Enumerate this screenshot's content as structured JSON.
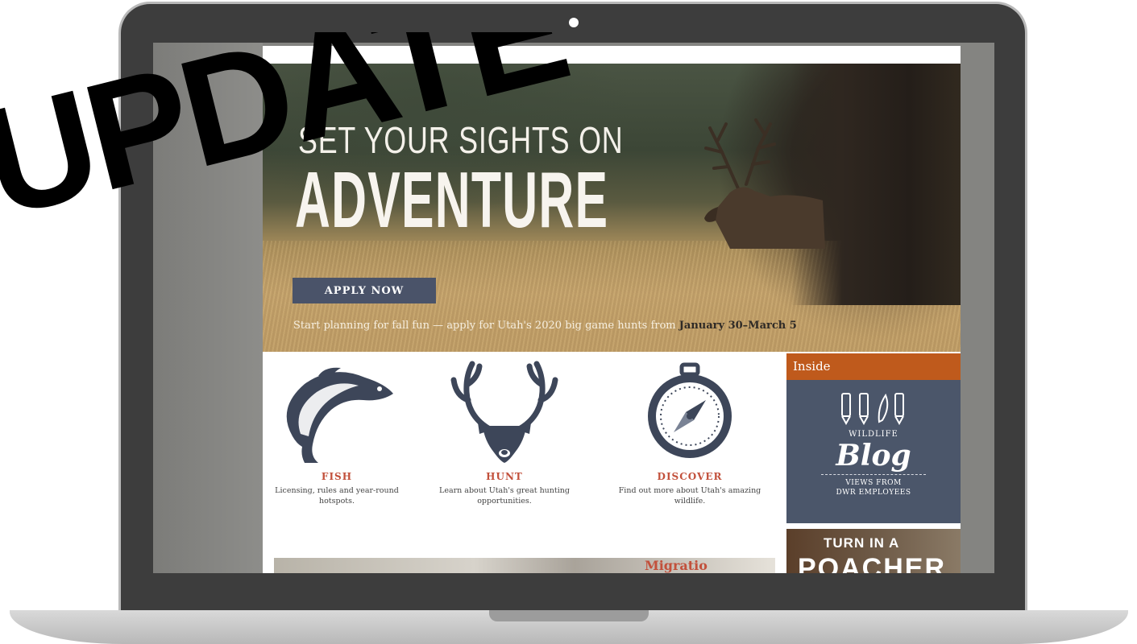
{
  "overlay": {
    "stamp_text": "UPDATE"
  },
  "hero": {
    "headline_top": "SET YOUR SIGHTS ON",
    "headline_main": "ADVENTURE",
    "button_label": "APPLY NOW",
    "caption_text": "Start planning for fall fun — apply for Utah's 2020 big game hunts from ",
    "caption_dates": "January 30–March 5"
  },
  "categories": [
    {
      "title": "FISH",
      "description": "Licensing, rules and year-round hotspots.",
      "icon": "fish-icon"
    },
    {
      "title": "HUNT",
      "description": "Learn about Utah's great hunting opportunities.",
      "icon": "deer-antlers-icon"
    },
    {
      "title": "DISCOVER",
      "description": "Find out more about Utah's amazing wildlife.",
      "icon": "compass-icon"
    }
  ],
  "sidebar": {
    "header": "Inside",
    "blog": {
      "kicker": "WILDLIFE",
      "title": "Blog",
      "sub_line1": "VIEWS FROM",
      "sub_line2": "DWR EMPLOYEES",
      "icon": "pens-icon"
    },
    "poacher": {
      "line1": "TURN IN A",
      "line2": "POACHER"
    }
  },
  "bottom_strip": {
    "partial_title": "Migratio"
  },
  "colors": {
    "accent_red": "#c2503b",
    "navy": "#4a5369",
    "inside_orange": "#bf5a1c",
    "blog_slate": "#4b566a"
  }
}
